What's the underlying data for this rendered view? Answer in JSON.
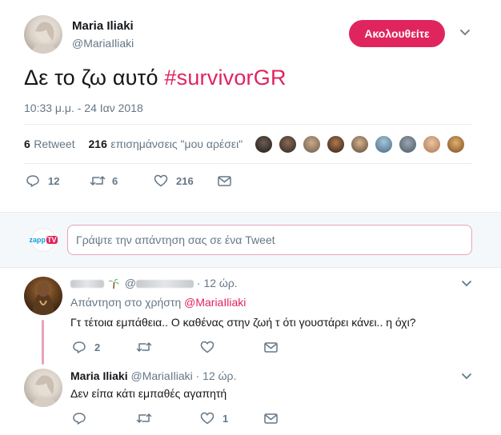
{
  "tweet": {
    "author_name": "Maria Iliaki",
    "author_handle": "@MariaIliaki",
    "follow_label": "Ακολουθείτε",
    "text_plain": "Δε το ζω αυτό ",
    "text_hashtag": "#survivorGR",
    "timestamp": "10:33 μ.μ. - 24 Ιαν 2018",
    "retweet_count": "6",
    "retweet_label": "Retweet",
    "like_count": "216",
    "like_label": "επισημάνσεις \"μου αρέσει\"",
    "actions": {
      "reply_count": "12",
      "retweet_count": "6",
      "like_count": "216"
    }
  },
  "reply_composer": {
    "badge_text_a": "zapp",
    "badge_text_b": "TV",
    "placeholder": "Γράψτε την απάντηση σας σε ένα Tweet"
  },
  "replies": [
    {
      "time": "· 12 ώρ.",
      "replying_prefix": "Απάντηση στο χρήστη",
      "replying_to": "@MariaIliaki",
      "text": "Γτ τέτοια εμπάθεια.. Ο καθένας στην ζωή τ ότι γουστάρει κάνει.. η όχι?",
      "reply_count": "2",
      "retweet_count": "",
      "like_count": ""
    },
    {
      "author_name": "Maria Iliaki",
      "author_handle": "@MariaIliaki",
      "time": "· 12 ώρ.",
      "text": "Δεν είπα κάτι εμπαθές αγαπητή",
      "reply_count": "",
      "retweet_count": "",
      "like_count": "1"
    }
  ],
  "colors": {
    "accent": "#e0245e",
    "muted_text": "#657786",
    "divider": "#e6ecf0",
    "composer_bg": "#f5f8fa"
  },
  "icons": [
    "chevron-down-icon",
    "reply-icon",
    "retweet-icon",
    "like-icon",
    "message-icon",
    "palm-tree-icon"
  ]
}
